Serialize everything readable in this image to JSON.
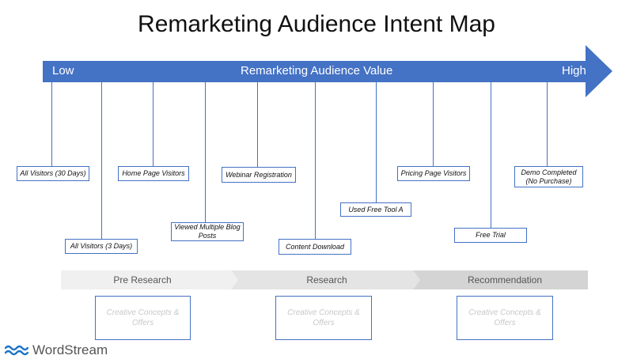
{
  "title": "Remarketing Audience Intent Map",
  "arrow": {
    "low_label": "Low",
    "center_label": "Remarketing Audience Value",
    "high_label": "High",
    "color": "#4472c4"
  },
  "audiences": [
    {
      "label": "All Visitors (30 Days)"
    },
    {
      "label": "All Visitors (3 Days)"
    },
    {
      "label": "Home Page Visitors"
    },
    {
      "label": "Viewed Multiple Blog Posts"
    },
    {
      "label": "Webinar Registration"
    },
    {
      "label": "Content Download"
    },
    {
      "label": "Used Free Tool A"
    },
    {
      "label": "Pricing Page Visitors"
    },
    {
      "label": "Free Trial"
    },
    {
      "label": "Demo Completed (No Purchase)"
    }
  ],
  "stages": [
    {
      "label": "Pre Research",
      "creative": "Creative Concepts & Offers"
    },
    {
      "label": "Research",
      "creative": "Creative Concepts & Offers"
    },
    {
      "label": "Recommendation",
      "creative": "Creative Concepts & Offers"
    }
  ],
  "brand": {
    "name": "WordStream",
    "icon": "wave-icon",
    "color": "#1a73c8"
  }
}
